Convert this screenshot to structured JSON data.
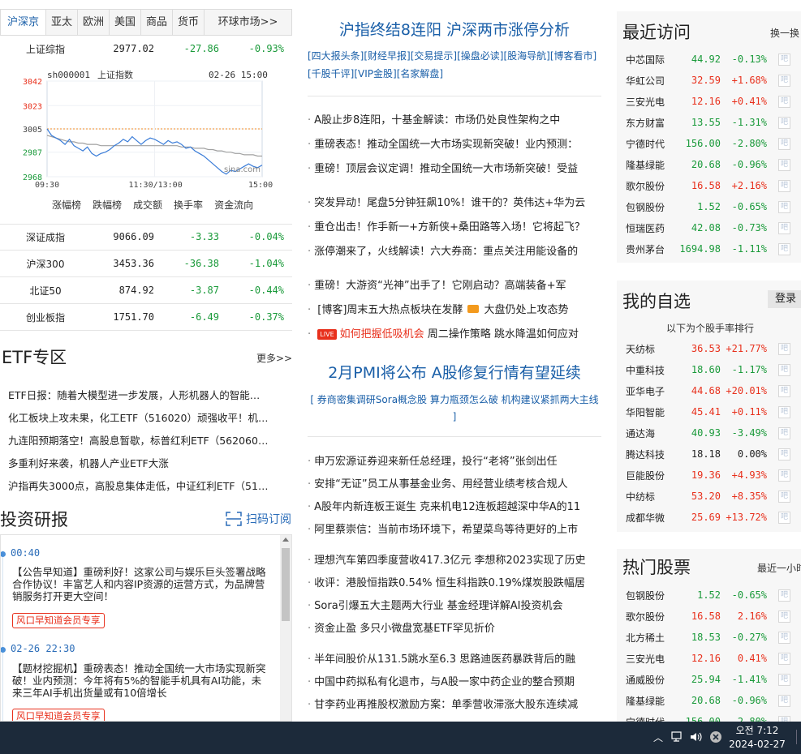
{
  "market_tabs": [
    "沪深京",
    "亚太",
    "欧洲",
    "美国",
    "商品",
    "货币",
    "环球市场>>"
  ],
  "indices_top": [
    {
      "name": "上证综指",
      "value": "2977.02",
      "change": "-27.86",
      "pct": "-0.93%",
      "dir": "dn"
    }
  ],
  "chart": {
    "symbol": "sh000001",
    "name": "上证指数",
    "date": "02-26 15:00",
    "y_labels": [
      "3042",
      "3023",
      "3005",
      "2987",
      "2968"
    ],
    "x_labels": [
      "09:30",
      "11:30/13:00",
      "15:00"
    ],
    "watermark": "sina.com",
    "ref_value": 3005,
    "ylim": [
      2968,
      3042
    ],
    "series": [
      3005,
      3000,
      2998,
      2996,
      2993,
      2997,
      2992,
      2990,
      2988,
      2991,
      2986,
      2984,
      2986,
      2987,
      2989,
      2992,
      2994,
      2997,
      2995,
      2999,
      2996,
      2993,
      2996,
      2998,
      2997,
      2995,
      2993,
      2996,
      2994,
      2995,
      2993,
      2990,
      2991,
      2988,
      2986,
      2984,
      2981,
      2978,
      2975,
      2972,
      2970,
      2973,
      2972,
      2974,
      2976,
      2978,
      2976,
      2975,
      2977
    ],
    "avg": [
      3000,
      2999,
      2998,
      2997,
      2996,
      2995,
      2995,
      2994,
      2994,
      2993,
      2993,
      2993,
      2992,
      2992,
      2992,
      2992,
      2992,
      2992,
      2992,
      2992,
      2992,
      2992,
      2992,
      2992,
      2992,
      2992,
      2992,
      2992,
      2992,
      2992,
      2991,
      2991,
      2991,
      2990,
      2990,
      2990,
      2989,
      2989,
      2988,
      2988,
      2987,
      2987,
      2986,
      2986,
      2985,
      2985,
      2985,
      2984,
      2984
    ]
  },
  "chart_tools": [
    "涨幅榜",
    "跌幅榜",
    "成交额",
    "换手率",
    "资金流向"
  ],
  "indices": [
    {
      "name": "深证成指",
      "value": "9066.09",
      "change": "-3.33",
      "pct": "-0.04%",
      "dir": "dn"
    },
    {
      "name": "沪深300",
      "value": "3453.36",
      "change": "-36.38",
      "pct": "-1.04%",
      "dir": "dn"
    },
    {
      "name": "北证50",
      "value": "874.92",
      "change": "-3.87",
      "pct": "-0.44%",
      "dir": "dn"
    },
    {
      "name": "创业板指",
      "value": "1751.70",
      "change": "-6.49",
      "pct": "-0.37%",
      "dir": "dn"
    }
  ],
  "etf": {
    "title": "ETF专区",
    "more": "更多>>",
    "items": [
      "ETF日报：随着大模型进一步发展，人形机器人的智能…",
      "化工板块上攻未果，化工ETF（516020）顽强收平！机…",
      "九连阳预期落空！高股息暂歇，标普红利ETF（562060…",
      "多重利好来袭，机器人产业ETF大涨",
      "沪指再失3000点，高股息集体走低，中证红利ETF（51…"
    ]
  },
  "research": {
    "title": "投资研报",
    "subscribe": "扫码订阅",
    "items": [
      {
        "time": "00:40",
        "text": "【公告早知道】重磅利好！这家公司与娱乐巨头签署战略合作协议！丰富艺人和内容IP资源的运营方式，为品牌营销服务打开更大空间！",
        "tag": "风口早知道会员专享"
      },
      {
        "time": "02-26 22:30",
        "text": "【题材挖掘机】重磅表态！推动全国统一大市场实现新突破！业内预测：今年将有5%的智能手机具有AI功能，未来三年AI手机出货量或有10倍增长",
        "tag": "风口早知道会员专享"
      }
    ]
  },
  "mid": {
    "headline1": "沪指终结8连阳 沪深两市涨停分析",
    "tags": "[四大报头条][财经早报][交易提示][操盘必读][股海导航][博客看市][千股千评][VIP金股][名家解盘]",
    "group1": [
      "A股止步8连阳，十基金解读：市场仍处良性架构之中",
      "重磅表态！推动全国统一大市场实现新突破！业内预测：",
      "重磅！顶层会议定调！推动全国统一大市场新突破！受益"
    ],
    "group2": [
      "突发异动！尾盘5分钟狂飙10%！谁干的？英伟达+华为云",
      "重仓出击！作手新一+方新侠+桑田路等入场！它将起飞？",
      "涨停潮来了，火线解读！六大券商：重点关注用能设备的"
    ],
    "group3": [
      "重磅！大游资“光神”出手了！它刚启动？高端装备+军"
    ],
    "blog_a": "[博客]周末五大热点板块在发酵",
    "blog_b": "大盘仍处上攻态势",
    "live_label": "LIVE",
    "live_a": "如何把握低吸机会",
    "live_b": "周二操作策略 跳水降温如何应对",
    "headline2": "2月PMI将公布 A股修复行情有望延续",
    "sub2": "[ 券商密集调研Sora概念股 算力瓶颈怎么破 机构建议紧抓两大主线 ]",
    "group4": [
      "申万宏源证券迎来新任总经理，投行“老将”张剑出任",
      "安排“无证”员工从事基金业务、用经营业绩考核合规人",
      "A股年内新连板王诞生 克来机电12连板超越深中华A的11",
      "阿里蔡崇信：当前市场环境下，希望菜鸟等待更好的上市"
    ],
    "group5": [
      "理想汽车第四季度营收417.3亿元 李想称2023实现了历史",
      "收评：港股恒指跌0.54% 恒生科指跌0.19%煤炭股跌幅居",
      "Sora引爆五大主题两大行业 基金经理详解AI投资机会",
      "资金止盈 多只小微盘宽基ETF罕见折价"
    ],
    "group6": [
      "半年间股价从131.5跳水至6.3 思路迪医药暴跌背后的融",
      "中国中药拟私有化退市，与A股一家中药企业的整合预期",
      "甘李药业再推股权激励方案：单季营收滞涨大股东连续减"
    ]
  },
  "recent": {
    "title": "最近访问",
    "switch": "换一换",
    "stocks": [
      {
        "name": "中芯国际",
        "price": "44.92",
        "pct": "-0.13%",
        "dir": "dn"
      },
      {
        "name": "华虹公司",
        "price": "32.59",
        "pct": "+1.68%",
        "dir": "up"
      },
      {
        "name": "三安光电",
        "price": "12.16",
        "pct": "+0.41%",
        "dir": "up"
      },
      {
        "name": "东方财富",
        "price": "13.55",
        "pct": "-1.31%",
        "dir": "dn"
      },
      {
        "name": "宁德时代",
        "price": "156.00",
        "pct": "-2.80%",
        "dir": "dn"
      },
      {
        "name": "隆基绿能",
        "price": "20.68",
        "pct": "-0.96%",
        "dir": "dn"
      },
      {
        "name": "歌尔股份",
        "price": "16.58",
        "pct": "+2.16%",
        "dir": "up"
      },
      {
        "name": "包钢股份",
        "price": "1.52",
        "pct": "-0.65%",
        "dir": "dn"
      },
      {
        "name": "恒瑞医药",
        "price": "42.08",
        "pct": "-0.73%",
        "dir": "dn"
      },
      {
        "name": "贵州茅台",
        "price": "1694.98",
        "pct": "-1.11%",
        "dir": "dn"
      }
    ]
  },
  "watch": {
    "title": "我的自选",
    "login": "登录",
    "subtitle": "以下为个股手率排行",
    "stocks": [
      {
        "name": "天纺标",
        "price": "36.53",
        "pct": "+21.77%",
        "dir": "up"
      },
      {
        "name": "中重科技",
        "price": "18.60",
        "pct": "-1.17%",
        "dir": "dn"
      },
      {
        "name": "亚华电子",
        "price": "44.68",
        "pct": "+20.01%",
        "dir": "up"
      },
      {
        "name": "华阳智能",
        "price": "45.41",
        "pct": "+0.11%",
        "dir": "up"
      },
      {
        "name": "通达海",
        "price": "40.93",
        "pct": "-3.49%",
        "dir": "dn"
      },
      {
        "name": "腾达科技",
        "price": "18.18",
        "pct": "0.00%",
        "dir": "flat"
      },
      {
        "name": "巨能股份",
        "price": "19.36",
        "pct": "+4.93%",
        "dir": "up"
      },
      {
        "name": "中纺标",
        "price": "53.20",
        "pct": "+8.35%",
        "dir": "up"
      },
      {
        "name": "成都华微",
        "price": "25.69",
        "pct": "+13.72%",
        "dir": "up"
      }
    ]
  },
  "hot": {
    "title": "热门股票",
    "period": "最近一小时",
    "stocks": [
      {
        "name": "包钢股份",
        "price": "1.52",
        "pct": "-0.65%",
        "dir": "dn"
      },
      {
        "name": "歌尔股份",
        "price": "16.58",
        "pct": "2.16%",
        "dir": "up"
      },
      {
        "name": "北方稀土",
        "price": "18.53",
        "pct": "-0.27%",
        "dir": "dn"
      },
      {
        "name": "三安光电",
        "price": "12.16",
        "pct": "0.41%",
        "dir": "up"
      },
      {
        "name": "通威股份",
        "price": "25.94",
        "pct": "-1.41%",
        "dir": "dn"
      },
      {
        "name": "隆基绿能",
        "price": "20.68",
        "pct": "-0.96%",
        "dir": "dn"
      },
      {
        "name": "宁德时代",
        "price": "156.00",
        "pct": "-2.80%",
        "dir": "dn"
      }
    ]
  },
  "bar_label": "吧",
  "taskbar": {
    "time": "오전 7:12",
    "date": "2024-02-27"
  }
}
